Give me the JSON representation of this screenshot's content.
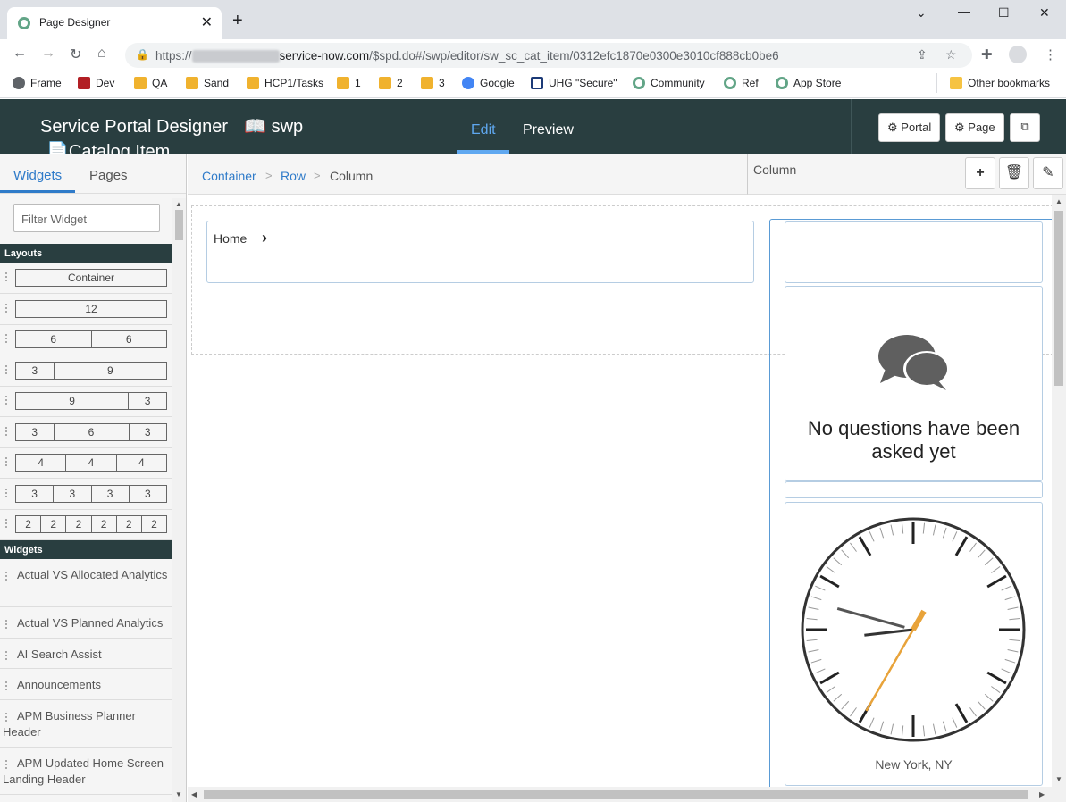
{
  "browser": {
    "tab_title": "Page Designer",
    "url_prefix": "https://",
    "url_host": "service-now.com",
    "url_path": "/$spd.do#/swp/editor/sw_sc_cat_item/0312efc1870e0300e3010cf888cb0be6",
    "bookmarks": [
      "Frame",
      "Dev",
      "QA",
      "Sand",
      "HCP1/Tasks",
      "1",
      "2",
      "3",
      "Google",
      "UHG \"Secure\"",
      "Community",
      "Ref",
      "App Store"
    ],
    "other_bookmarks": "Other bookmarks",
    "colors": {
      "tabbar": "#dee1e6",
      "omnibox": "#f1f3f4"
    }
  },
  "app": {
    "title": "Service Portal Designer",
    "portal_name": "swp",
    "page_name": "Catalog Item",
    "tabs": {
      "edit": "Edit",
      "preview": "Preview"
    },
    "buttons": {
      "portal": "Portal",
      "page": "Page"
    },
    "colors": {
      "header": "#293e40",
      "accent": "#5fa8f0"
    }
  },
  "left_panel": {
    "tabs": {
      "widgets": "Widgets",
      "pages": "Pages"
    },
    "filter_placeholder": "Filter Widget",
    "layouts_heading": "Layouts",
    "layouts": [
      [
        "Container"
      ],
      [
        "12"
      ],
      [
        "6",
        "6"
      ],
      [
        "3",
        "9"
      ],
      [
        "9",
        "3"
      ],
      [
        "3",
        "6",
        "3"
      ],
      [
        "4",
        "4",
        "4"
      ],
      [
        "3",
        "3",
        "3",
        "3"
      ],
      [
        "2",
        "2",
        "2",
        "2",
        "2",
        "2"
      ]
    ],
    "widgets_heading": "Widgets",
    "widgets": [
      "Actual VS Allocated Analytics",
      "Actual VS Planned Analytics",
      "AI Search Assist",
      "Announcements",
      "APM Business Planner Header",
      "APM Updated Home Screen Landing Header"
    ]
  },
  "breadcrumb": {
    "items": [
      "Container",
      "Row",
      "Column"
    ]
  },
  "properties": {
    "label": "Column"
  },
  "canvas": {
    "home_link": "Home",
    "no_questions": "No questions have been asked yet",
    "clock_city": "New York, NY",
    "clock_time": {
      "hour": 8,
      "minute": 47,
      "second": 35
    }
  }
}
